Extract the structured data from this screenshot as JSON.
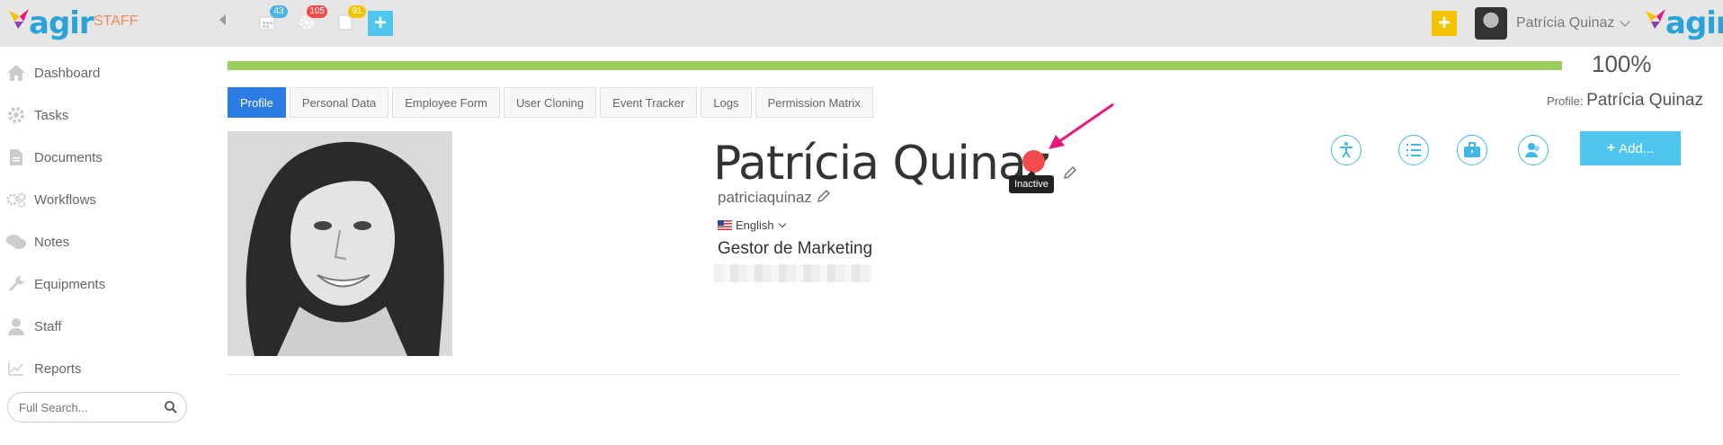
{
  "header": {
    "brand": "agir",
    "section_label": "STAFF",
    "calendar_count": "43",
    "settings_count": "105",
    "documents_count": "91",
    "user_name": "Patrícia Quinaz",
    "icons": [
      "calendar-icon",
      "gear-icon",
      "document-icon",
      "plus-icon"
    ]
  },
  "sidebar": {
    "items": [
      {
        "label": "Dashboard",
        "icon": "home-icon"
      },
      {
        "label": "Tasks",
        "icon": "gear-icon"
      },
      {
        "label": "Documents",
        "icon": "document-icon"
      },
      {
        "label": "Workflows",
        "icon": "gears-icon"
      },
      {
        "label": "Notes",
        "icon": "comments-icon"
      },
      {
        "label": "Equipments",
        "icon": "wrench-icon"
      },
      {
        "label": "Staff",
        "icon": "user-icon"
      },
      {
        "label": "Reports",
        "icon": "chart-icon"
      }
    ],
    "search_placeholder": "Full Search..."
  },
  "main": {
    "progress": {
      "value": 1.0,
      "label": "100%"
    },
    "tabs": [
      {
        "label": "Profile",
        "active": true
      },
      {
        "label": "Personal Data"
      },
      {
        "label": "Employee Form"
      },
      {
        "label": "User Cloning"
      },
      {
        "label": "Event Tracker"
      },
      {
        "label": "Logs"
      },
      {
        "label": "Permission Matrix"
      }
    ],
    "profile_caption": {
      "prefix": "Profile:",
      "name": "Patrícia Quinaz"
    },
    "profile": {
      "full_name": "Patrícia Quinaz",
      "status_tooltip": "Inactive",
      "status_color": "#f44c4c",
      "username": "patriciaquinaz",
      "language": "English",
      "job_title": "Gestor de Marketing"
    },
    "actions": {
      "icons": [
        "accessibility-icon",
        "list-icon",
        "briefcase-icon",
        "users-icon"
      ],
      "add_label": "Add..."
    }
  },
  "colors": {
    "accent_blue": "#2b7de3",
    "progress_green": "#9ccc5b",
    "brand_blue": "#2aa3d8",
    "add_button": "#4fc6f0",
    "annotation_arrow": "#e8197b"
  }
}
